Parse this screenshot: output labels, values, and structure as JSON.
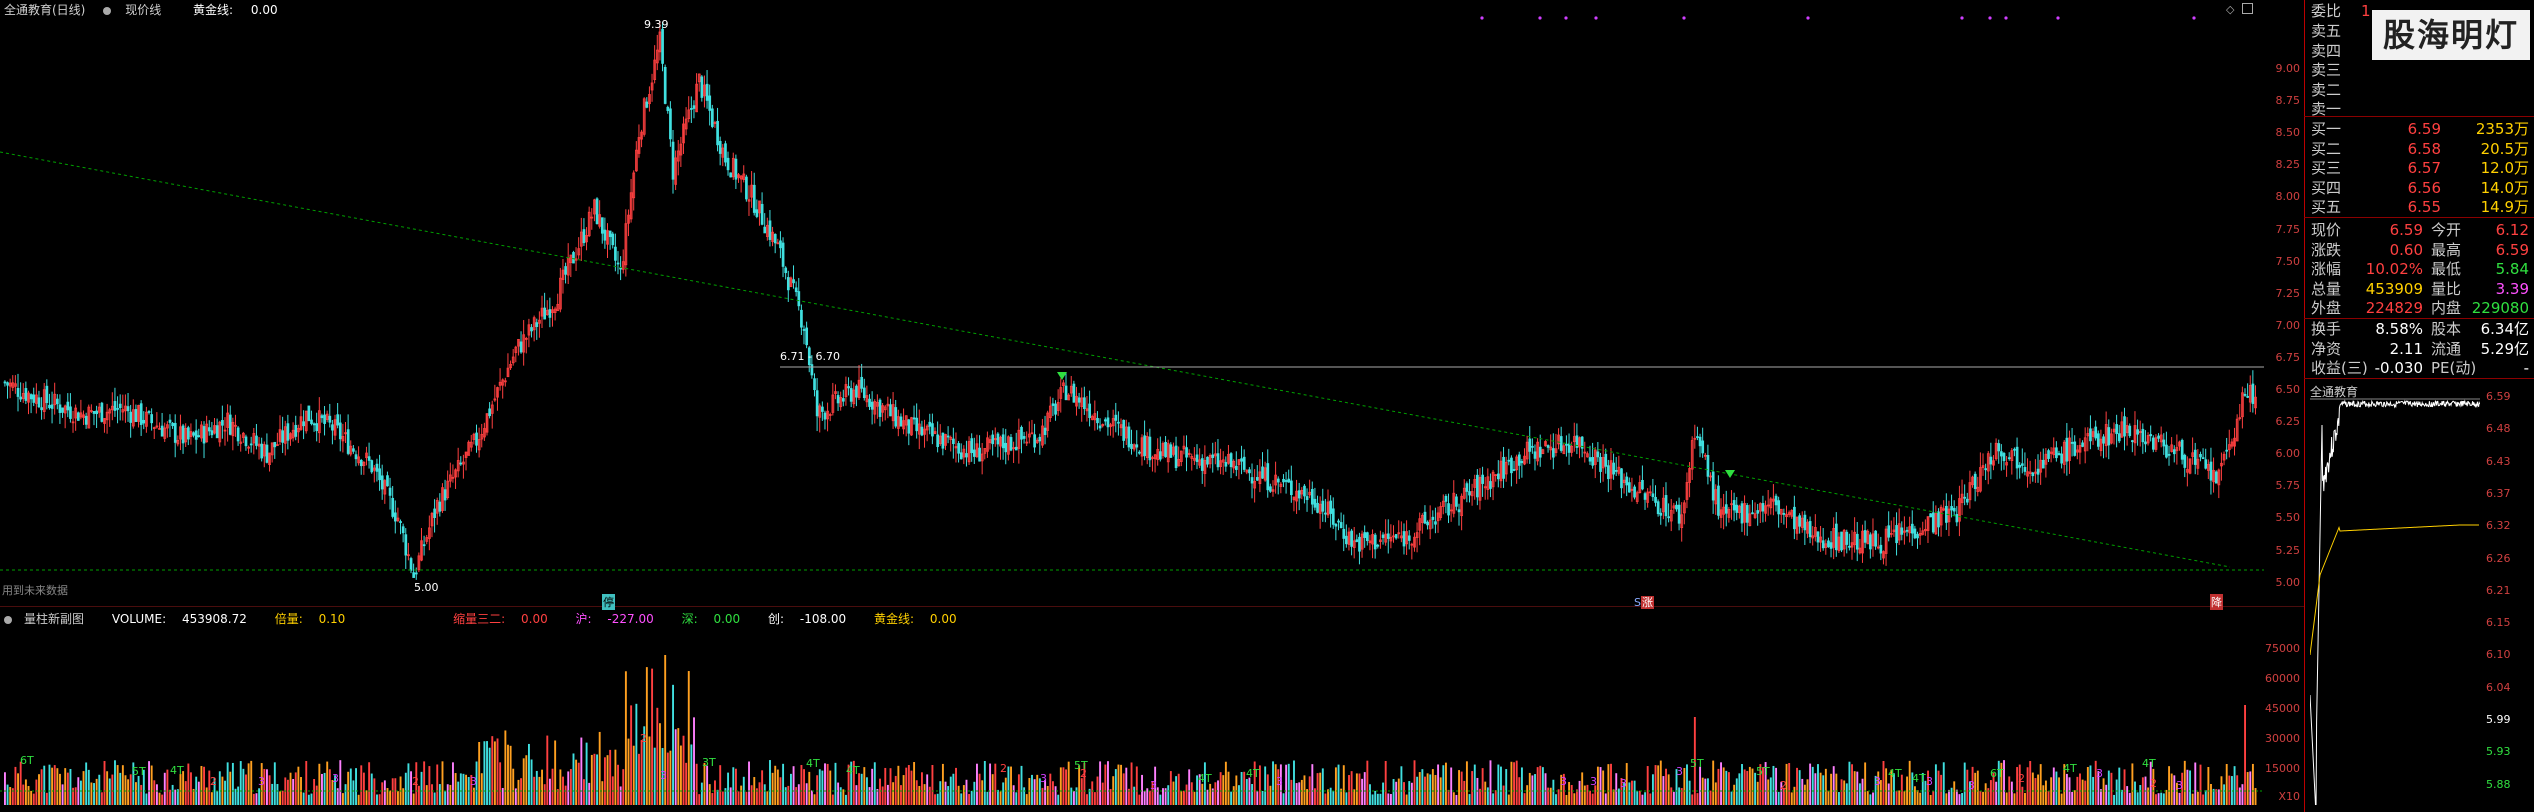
{
  "header": {
    "stock_name": "全通教育(日线)",
    "indicator1": "现价线",
    "indicator2_label": "黄金线:",
    "indicator2_value": "0.00"
  },
  "price_axis": [
    "9.00",
    "8.75",
    "8.50",
    "8.25",
    "8.00",
    "7.75",
    "7.50",
    "7.25",
    "7.00",
    "6.75",
    "6.50",
    "6.25",
    "6.00",
    "5.75",
    "5.50",
    "5.25",
    "5.00"
  ],
  "annotations": {
    "high_label": "9.39",
    "low_label": "5.00",
    "resistance_label": "6.71 - 6.70",
    "future_label": "用到未来数据",
    "tag_ting": "停",
    "tag_zhang": "涨",
    "tag_zhang_prefix": "S",
    "tag_jiang": "降"
  },
  "volume_panel": {
    "title": "量柱新副图",
    "volume_label": "VOLUME:",
    "volume_value": "453908.72",
    "beiliang_label": "倍量:",
    "beiliang_value": "0.10",
    "suoliang_label": "缩量三二:",
    "suoliang_value": "0.00",
    "hu_label": "沪:",
    "hu_value": "-227.00",
    "shen_label": "深:",
    "shen_value": "0.00",
    "chuang_label": "创:",
    "chuang_value": "-108.00",
    "huangjin_label": "黄金线:",
    "huangjin_value": "0.00",
    "axis": [
      "75000",
      "60000",
      "45000",
      "30000",
      "15000",
      "X10"
    ]
  },
  "marks": {
    "t_labels": [
      "6T",
      "5T",
      "4T",
      "3T",
      "4T",
      "4T",
      "5T",
      "4T",
      "4T",
      "5T",
      "5T",
      "4T",
      "4T",
      "6T",
      "4T",
      "4T"
    ],
    "num_labels": [
      "2",
      "3",
      "3",
      "3",
      "2",
      "2",
      "3",
      "2",
      "3",
      "2",
      "3",
      "3",
      "3",
      "3",
      "3",
      "3",
      "2",
      "3",
      "3",
      "3",
      "2",
      "3",
      "2",
      "3"
    ]
  },
  "right_panel": {
    "weibi_label": "委比",
    "weibi_value": "1",
    "sell": [
      {
        "label": "卖五",
        "price": "¥",
        "vol": ""
      },
      {
        "label": "卖四",
        "price": "",
        "vol": ""
      },
      {
        "label": "卖三",
        "price": "",
        "vol": ""
      },
      {
        "label": "卖二",
        "price": "",
        "vol": ""
      },
      {
        "label": "卖一",
        "price": "",
        "vol": ""
      }
    ],
    "buy": [
      {
        "label": "买一",
        "price": "6.59",
        "vol": "2353万"
      },
      {
        "label": "买二",
        "price": "6.58",
        "vol": "20.5万"
      },
      {
        "label": "买三",
        "price": "6.57",
        "vol": "12.0万"
      },
      {
        "label": "买四",
        "price": "6.56",
        "vol": "14.0万"
      },
      {
        "label": "买五",
        "price": "6.55",
        "vol": "14.9万"
      }
    ],
    "stats": [
      {
        "l1": "现价",
        "v1": "6.59",
        "c1": "red",
        "l2": "今开",
        "v2": "6.12",
        "c2": "red"
      },
      {
        "l1": "涨跌",
        "v1": "0.60",
        "c1": "red",
        "l2": "最高",
        "v2": "6.59",
        "c2": "red"
      },
      {
        "l1": "涨幅",
        "v1": "10.02%",
        "c1": "red",
        "l2": "最低",
        "v2": "5.84",
        "c2": "green"
      },
      {
        "l1": "总量",
        "v1": "453909",
        "c1": "yellow",
        "l2": "量比",
        "v2": "3.39",
        "c2": "magenta"
      },
      {
        "l1": "外盘",
        "v1": "224829",
        "c1": "red",
        "l2": "内盘",
        "v2": "229080",
        "c2": "green"
      }
    ],
    "stats2": [
      {
        "l1": "换手",
        "v1": "8.58%",
        "c1": "white",
        "l2": "股本",
        "v2": "6.34亿",
        "c2": "white"
      },
      {
        "l1": "净资",
        "v1": "2.11",
        "c1": "white",
        "l2": "流通",
        "v2": "5.29亿",
        "c2": "white"
      },
      {
        "l1": "收益(三)",
        "v1": "-0.030",
        "c1": "white",
        "l2": "PE(动)",
        "v2": "-",
        "c2": "white"
      }
    ],
    "watermark": "股海明灯",
    "mini_title": "全通教育",
    "mini_axis": [
      "6.59",
      "6.48",
      "6.43",
      "6.37",
      "6.32",
      "6.26",
      "6.21",
      "6.15",
      "6.10",
      "6.04",
      "5.99",
      "5.93",
      "5.88"
    ]
  },
  "colors": {
    "up": "#ff4040",
    "down": "#40e0e0",
    "ma": "#00a000",
    "bg": "#000000"
  }
}
